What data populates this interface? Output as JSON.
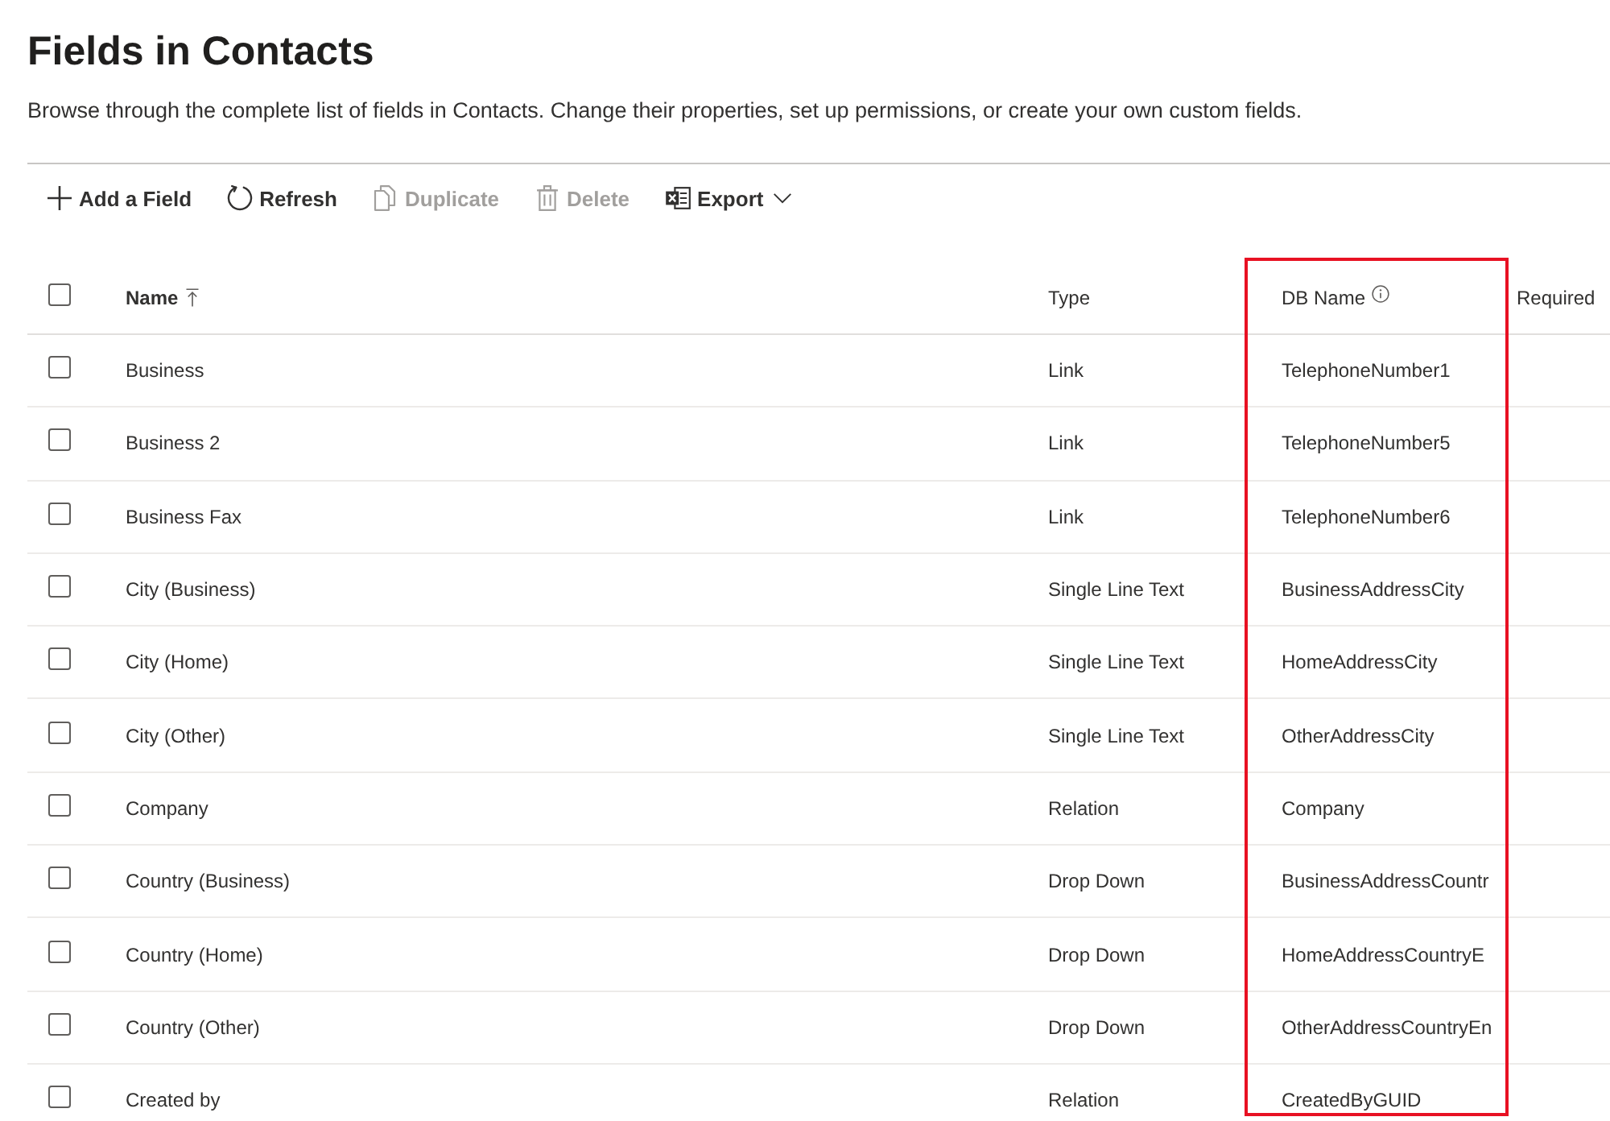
{
  "page": {
    "title": "Fields in Contacts",
    "description": "Browse through the complete list of fields in Contacts. Change their properties, set up permissions, or create your own custom fields."
  },
  "toolbar": [
    {
      "kind": "add",
      "label": "Add a Field",
      "disabled": false
    },
    {
      "kind": "refresh",
      "label": "Refresh",
      "disabled": false
    },
    {
      "kind": "duplicate",
      "label": "Duplicate",
      "disabled": true
    },
    {
      "kind": "delete",
      "label": "Delete",
      "disabled": true
    },
    {
      "kind": "export",
      "label": "Export",
      "disabled": false
    }
  ],
  "table": {
    "select_all": {
      "checked": false
    },
    "columns": [
      {
        "label": "Name",
        "sorted": true,
        "info": false,
        "highlighted": false
      },
      {
        "label": "Type",
        "sorted": false,
        "info": false,
        "highlighted": false
      },
      {
        "label": "DB Name",
        "sorted": false,
        "info": true,
        "highlighted": true
      },
      {
        "label": "Required",
        "sorted": false,
        "info": false,
        "highlighted": false
      }
    ],
    "rows": [
      {
        "checked": false,
        "cells": [
          "Business",
          "Link",
          "TelephoneNumber1"
        ]
      },
      {
        "checked": false,
        "cells": [
          "Business 2",
          "Link",
          "TelephoneNumber5"
        ]
      },
      {
        "checked": false,
        "cells": [
          "Business Fax",
          "Link",
          "TelephoneNumber6"
        ]
      },
      {
        "checked": false,
        "cells": [
          "City (Business)",
          "Single Line Text",
          "BusinessAddressCity"
        ]
      },
      {
        "checked": false,
        "cells": [
          "City (Home)",
          "Single Line Text",
          "HomeAddressCity"
        ]
      },
      {
        "checked": false,
        "cells": [
          "City (Other)",
          "Single Line Text",
          "OtherAddressCity"
        ]
      },
      {
        "checked": false,
        "cells": [
          "Company",
          "Relation",
          "Company"
        ]
      },
      {
        "checked": false,
        "cells": [
          "Country (Business)",
          "Drop Down",
          "BusinessAddressCountr"
        ]
      },
      {
        "checked": false,
        "cells": [
          "Country (Home)",
          "Drop Down",
          "HomeAddressCountryE"
        ]
      },
      {
        "checked": false,
        "cells": [
          "Country (Other)",
          "Drop Down",
          "OtherAddressCountryEn"
        ]
      },
      {
        "checked": false,
        "cells": [
          "Created by",
          "Relation",
          "CreatedByGUID"
        ]
      }
    ]
  }
}
